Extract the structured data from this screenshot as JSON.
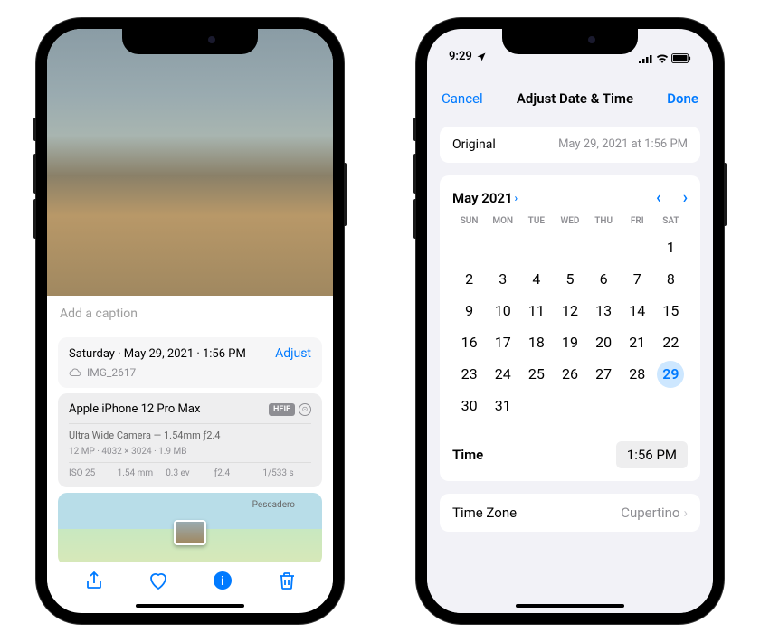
{
  "left": {
    "caption_placeholder": "Add a caption",
    "date_line": "Saturday · May 29, 2021 · 1:56 PM",
    "adjust_label": "Adjust",
    "image_name": "IMG_2617",
    "device": {
      "name": "Apple iPhone 12 Pro Max",
      "format_badge": "HEIF",
      "camera": "Ultra Wide Camera — 1.54mm ƒ2.4",
      "specs": "12 MP · 4032 × 3024 · 1.9 MB",
      "exif": {
        "iso": "ISO 25",
        "focal": "1.54 mm",
        "ev": "0.3 ev",
        "aperture": "ƒ2.4",
        "shutter": "1/533 s"
      }
    },
    "map_location": "Pescadero"
  },
  "right": {
    "status_time": "9:29",
    "header": {
      "cancel": "Cancel",
      "title": "Adjust Date & Time",
      "done": "Done"
    },
    "original": {
      "label": "Original",
      "value": "May 29, 2021 at 1:56 PM"
    },
    "calendar": {
      "month_label": "May 2021",
      "weekdays": [
        "SUN",
        "MON",
        "TUE",
        "WED",
        "THU",
        "FRI",
        "SAT"
      ],
      "leading_blanks": 6,
      "days": 31,
      "selected_day": 29
    },
    "time": {
      "label": "Time",
      "value": "1:56 PM"
    },
    "timezone": {
      "label": "Time Zone",
      "value": "Cupertino"
    }
  }
}
